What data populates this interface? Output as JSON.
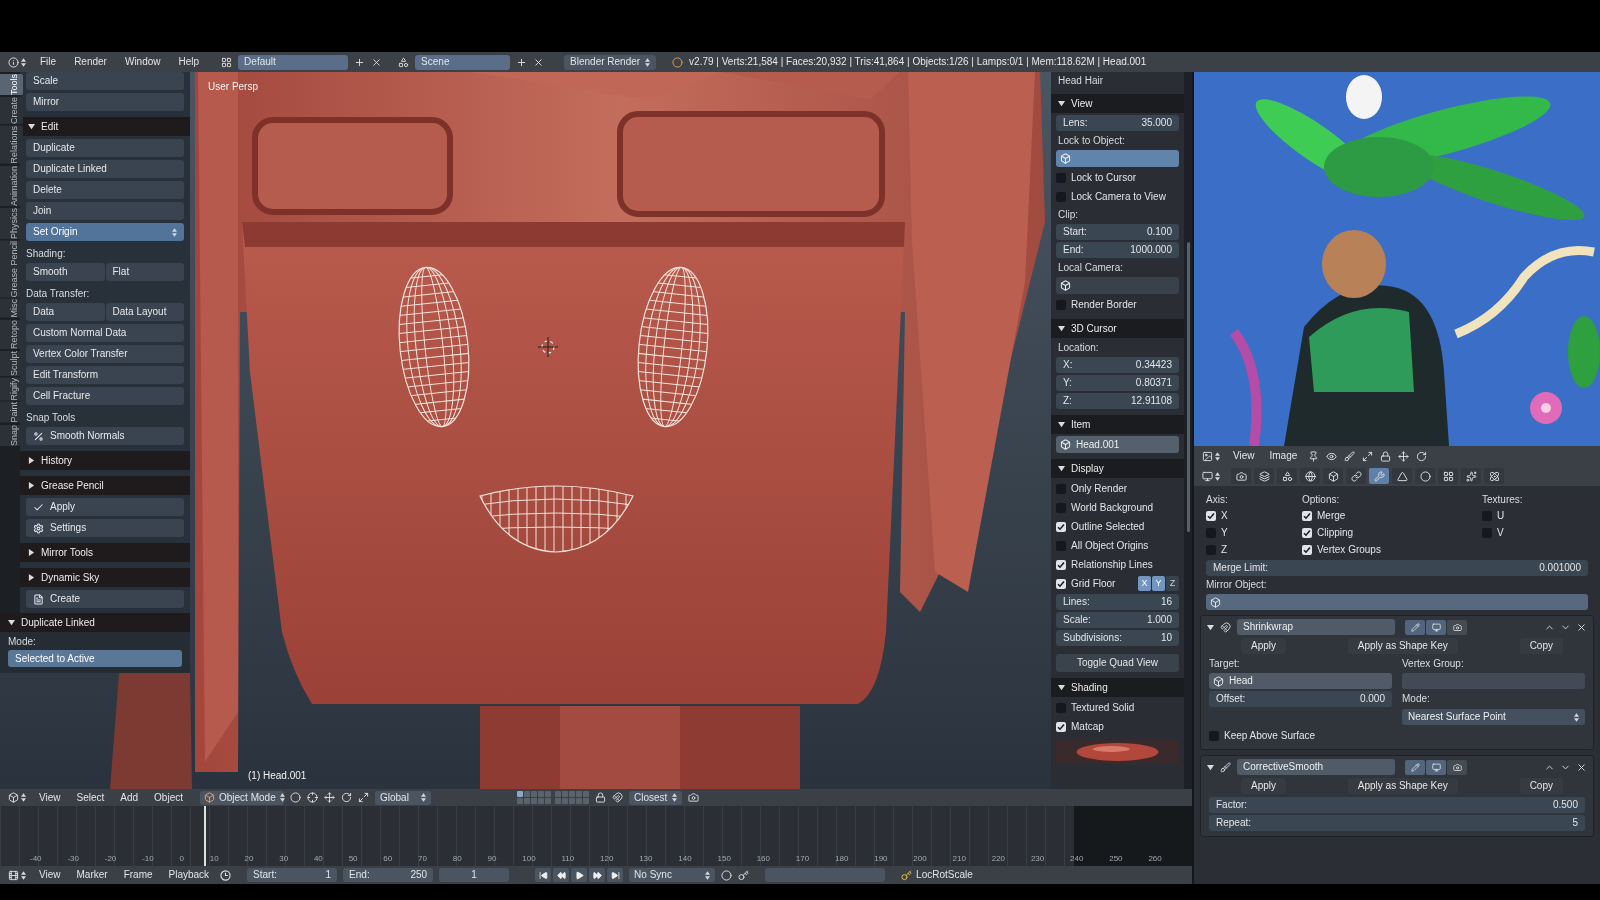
{
  "info_header": {
    "menus": [
      "File",
      "Render",
      "Window",
      "Help"
    ],
    "screen_layout": "Default",
    "scene": "Scene",
    "render_engine": "Blender Render",
    "stats": "v2.79 | Verts:21,584 | Faces:20,932 | Tris:41,864 | Objects:1/26 | Lamps:0/1 | Mem:118.62M | Head.001"
  },
  "tool_shelf": {
    "tabs": [
      {
        "label": "Tools",
        "selected": true
      },
      {
        "label": "Create",
        "selected": false
      },
      {
        "label": "Relations",
        "selected": false
      },
      {
        "label": "Animation",
        "selected": false
      },
      {
        "label": "Physics",
        "selected": false
      },
      {
        "label": "Grease Pencil",
        "selected": false
      },
      {
        "label": "Misc",
        "selected": false
      },
      {
        "label": "Retopo",
        "selected": false
      },
      {
        "label": "Sculpt",
        "selected": false
      },
      {
        "label": "Rigify",
        "selected": false
      },
      {
        "label": "Paint",
        "selected": false
      },
      {
        "label": "Snap",
        "selected": false
      }
    ],
    "items": [
      {
        "kind": "button",
        "label": "Scale"
      },
      {
        "kind": "button",
        "label": "Mirror"
      },
      {
        "kind": "panel",
        "label": "Edit",
        "expanded": true
      },
      {
        "kind": "button",
        "label": "Duplicate"
      },
      {
        "kind": "button",
        "label": "Duplicate Linked"
      },
      {
        "kind": "button",
        "label": "Delete"
      },
      {
        "kind": "button",
        "label": "Join"
      },
      {
        "kind": "dropdown",
        "label": "Set Origin"
      },
      {
        "kind": "label",
        "label": "Shading:"
      },
      {
        "kind": "pair",
        "labels": [
          "Smooth",
          "Flat"
        ]
      },
      {
        "kind": "label",
        "label": "Data Transfer:"
      },
      {
        "kind": "pair",
        "labels": [
          "Data",
          "Data Layout"
        ]
      },
      {
        "kind": "button",
        "label": "Custom Normal Data"
      },
      {
        "kind": "button",
        "label": "Vertex Color Transfer"
      },
      {
        "kind": "button",
        "label": "Edit Transform"
      },
      {
        "kind": "button",
        "label": "Cell Fracture"
      },
      {
        "kind": "label",
        "label": "Snap Tools"
      },
      {
        "kind": "icon_button",
        "label": "Smooth Normals"
      },
      {
        "kind": "panel",
        "label": "History",
        "expanded": false
      },
      {
        "kind": "panel",
        "label": "Grease Pencil",
        "expanded": false
      },
      {
        "kind": "icon_button",
        "label": "Apply"
      },
      {
        "kind": "icon_button",
        "label": "Settings"
      },
      {
        "kind": "panel",
        "label": "Mirror Tools",
        "expanded": false
      },
      {
        "kind": "panel",
        "label": "Dynamic Sky",
        "expanded": false
      },
      {
        "kind": "icon_button",
        "label": "Create"
      }
    ]
  },
  "redo_panel": {
    "title": "Duplicate Linked",
    "expanded": true,
    "label": "Mode:",
    "value": "Selected to Active"
  },
  "viewport": {
    "view_label": "User Persp",
    "object_label": "(1) Head.001"
  },
  "n_panel": {
    "items": [
      {
        "kind": "label",
        "label": "Head Hair"
      },
      {
        "kind": "panel",
        "label": "View",
        "expanded": true
      },
      {
        "kind": "field",
        "label": "Lens:",
        "value": "35.000"
      },
      {
        "kind": "label",
        "label": "Lock to Object:"
      },
      {
        "kind": "object_field",
        "highlighted": true
      },
      {
        "kind": "checkbox",
        "label": "Lock to Cursor",
        "checked": false
      },
      {
        "kind": "checkbox",
        "label": "Lock Camera to View",
        "checked": false
      },
      {
        "kind": "label",
        "label": "Clip:"
      },
      {
        "kind": "field",
        "label": "Start:",
        "value": "0.100"
      },
      {
        "kind": "field",
        "label": "End:",
        "value": "1000.000"
      },
      {
        "kind": "label",
        "label": "Local Camera:"
      },
      {
        "kind": "object_field",
        "highlighted": false
      },
      {
        "kind": "checkbox",
        "label": "Render Border",
        "checked": false
      },
      {
        "kind": "panel",
        "label": "3D Cursor",
        "expanded": true
      },
      {
        "kind": "label",
        "label": "Location:"
      },
      {
        "kind": "field",
        "label": "X:",
        "value": "0.34423"
      },
      {
        "kind": "field",
        "label": "Y:",
        "value": "0.80371"
      },
      {
        "kind": "field",
        "label": "Z:",
        "value": "12.91108"
      },
      {
        "kind": "panel",
        "label": "Item",
        "expanded": true
      },
      {
        "kind": "name_field",
        "value": "Head.001"
      },
      {
        "kind": "panel",
        "label": "Display",
        "expanded": true
      },
      {
        "kind": "checkbox",
        "label": "Only Render",
        "checked": false
      },
      {
        "kind": "checkbox",
        "label": "World Background",
        "checked": false
      },
      {
        "kind": "checkbox",
        "label": "Outline Selected",
        "checked": true
      },
      {
        "kind": "checkbox",
        "label": "All Object Origins",
        "checked": false
      },
      {
        "kind": "checkbox",
        "label": "Relationship Lines",
        "checked": true
      },
      {
        "kind": "grid_checkbox",
        "label": "Grid Floor",
        "checked": true,
        "axes": [
          {
            "label": "X",
            "selected": true
          },
          {
            "label": "Y",
            "selected": true
          },
          {
            "label": "Z",
            "selected": false
          }
        ]
      },
      {
        "kind": "field",
        "label": "Lines:",
        "value": "16"
      },
      {
        "kind": "field",
        "label": "Scale:",
        "value": "1.000"
      },
      {
        "kind": "field",
        "label": "Subdivisions:",
        "value": "10"
      },
      {
        "kind": "button",
        "label": "Toggle Quad View"
      },
      {
        "kind": "panel",
        "label": "Shading",
        "expanded": true
      },
      {
        "kind": "checkbox",
        "label": "Textured Solid",
        "checked": false
      },
      {
        "kind": "checkbox",
        "label": "Matcap",
        "checked": true
      },
      {
        "kind": "matcap"
      }
    ]
  },
  "viewport_header": {
    "menus": [
      "View",
      "Select",
      "Add",
      "Object"
    ],
    "mode": "Object Mode",
    "orientation": "Global",
    "layers": [
      {
        "selected": true
      },
      {
        "selected": false
      },
      {
        "selected": false
      },
      {
        "selected": false
      },
      {
        "selected": false
      },
      {
        "selected": false
      },
      {
        "selected": false
      },
      {
        "selected": false
      },
      {
        "selected": false
      },
      {
        "selected": false
      },
      {
        "selected": false
      },
      {
        "selected": false
      },
      {
        "selected": false
      },
      {
        "selected": false
      },
      {
        "selected": false
      },
      {
        "selected": false
      },
      {
        "selected": false
      },
      {
        "selected": false
      },
      {
        "selected": false
      },
      {
        "selected": false
      }
    ],
    "snap_element": "Closest"
  },
  "timeline": {
    "ruler_labels": [
      "-40",
      "-30",
      "-20",
      "-10",
      "0",
      "10",
      "20",
      "30",
      "40",
      "50",
      "60",
      "70",
      "80",
      "90",
      "100",
      "110",
      "120",
      "130",
      "140",
      "150",
      "160",
      "170",
      "180",
      "190",
      "200",
      "210",
      "220",
      "230",
      "240",
      "250",
      "260"
    ],
    "menus": [
      "View",
      "Marker",
      "Frame",
      "Playback"
    ],
    "start": {
      "label": "Start:",
      "value": "1"
    },
    "end": {
      "label": "End:",
      "value": "250"
    },
    "current_frame": "1",
    "sync": "No Sync",
    "keying_set": "LocRotScale"
  },
  "image_editor": {
    "menus": [
      "View",
      "Image"
    ]
  },
  "properties": {
    "context_tabs": [
      {
        "kind": "render",
        "selected": false
      },
      {
        "kind": "layers",
        "selected": false
      },
      {
        "kind": "scene",
        "selected": false
      },
      {
        "kind": "world",
        "selected": false
      },
      {
        "kind": "object",
        "selected": false
      },
      {
        "kind": "constraints",
        "selected": false
      },
      {
        "kind": "modifiers",
        "selected": true
      },
      {
        "kind": "data",
        "selected": false
      },
      {
        "kind": "material",
        "selected": false
      },
      {
        "kind": "texture",
        "selected": false
      },
      {
        "kind": "particles",
        "selected": false
      },
      {
        "kind": "physics",
        "selected": false
      }
    ],
    "mirror": {
      "axis_title": "Axis:",
      "options_title": "Options:",
      "textures_title": "Textures:",
      "axes": [
        {
          "label": "X",
          "checked": true
        },
        {
          "label": "Y",
          "checked": false
        },
        {
          "label": "Z",
          "checked": false
        }
      ],
      "options": [
        {
          "label": "Merge",
          "checked": true
        },
        {
          "label": "Clipping",
          "checked": true
        },
        {
          "label": "Vertex Groups",
          "checked": true
        }
      ],
      "textures": [
        {
          "label": "U",
          "checked": false
        },
        {
          "label": "V",
          "checked": false
        }
      ],
      "merge_limit": {
        "label": "Merge Limit:",
        "value": "0.001000"
      },
      "mirror_object_label": "Mirror Object:"
    },
    "modifiers": [
      {
        "kind": "shrinkwrap",
        "name": "Shrinkwrap",
        "expanded": true,
        "actions": [
          "Apply",
          "Apply as Shape Key",
          "Copy"
        ],
        "target_label": "Target:",
        "target": "Head",
        "vgroup_label": "Vertex Group:",
        "offset": {
          "label": "Offset:",
          "value": "0.000"
        },
        "mode_label": "Mode:",
        "mode": "Nearest Surface Point",
        "keep_above": {
          "label": "Keep Above Surface",
          "checked": false
        }
      },
      {
        "kind": "corrective_smooth",
        "name": "CorrectiveSmooth",
        "expanded": true,
        "actions": [
          "Apply",
          "Apply as Shape Key",
          "Copy"
        ],
        "fields": [
          {
            "label": "Factor:",
            "value": "0.500"
          },
          {
            "label": "Repeat:",
            "value": "5"
          }
        ]
      }
    ]
  }
}
